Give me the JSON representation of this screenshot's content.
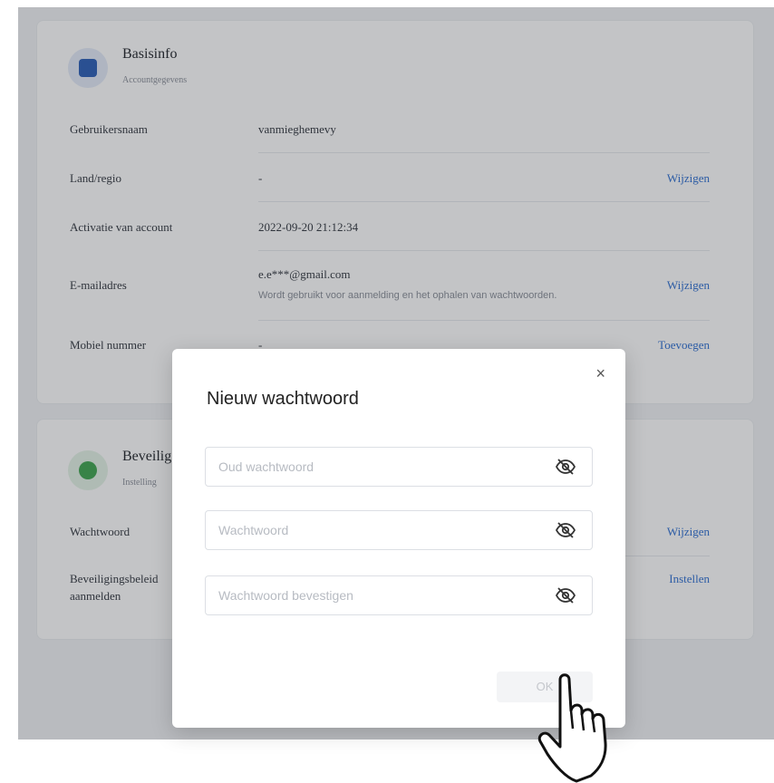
{
  "basic_info": {
    "title": "Basisinfo",
    "subtitle": "Accountgegevens",
    "icon": "account-card-icon",
    "rows": {
      "username": {
        "label": "Gebruikersnaam",
        "value": "vanmieghemevy"
      },
      "region": {
        "label": "Land/regio",
        "value": "-",
        "action": "Wijzigen"
      },
      "activation": {
        "label": "Activatie van account",
        "value": "2022-09-20 21:12:34"
      },
      "email": {
        "label": "E-mailadres",
        "value": "e.e***@gmail.com",
        "hint": "Wordt gebruikt voor aanmelding en het ophalen van wachtwoorden.",
        "action": "Wijzigen"
      },
      "mobile": {
        "label": "Mobiel nummer",
        "value": "-",
        "action": "Toevoegen"
      }
    }
  },
  "security": {
    "title": "Beveilig",
    "subtitle": "Instelling",
    "icon": "shield-check-icon",
    "rows": {
      "password": {
        "label": "Wachtwoord",
        "action": "Wijzigen"
      },
      "login_policy": {
        "label_line1": "Beveiligingsbeleid",
        "label_line2": "aanmelden",
        "action": "Instellen"
      }
    }
  },
  "modal": {
    "title": "Nieuw wachtwoord",
    "close_symbol": "×",
    "fields": {
      "old_password": {
        "placeholder": "Oud wachtwoord",
        "value": ""
      },
      "new_password": {
        "placeholder": "Wachtwoord",
        "value": ""
      },
      "confirm_password": {
        "placeholder": "Wachtwoord bevestigen",
        "value": ""
      }
    },
    "ok_label": "OK",
    "ok_enabled": false
  },
  "colors": {
    "link": "#2f6fd1",
    "shield_green": "#3fa550",
    "account_blue": "#2b5fb8"
  }
}
